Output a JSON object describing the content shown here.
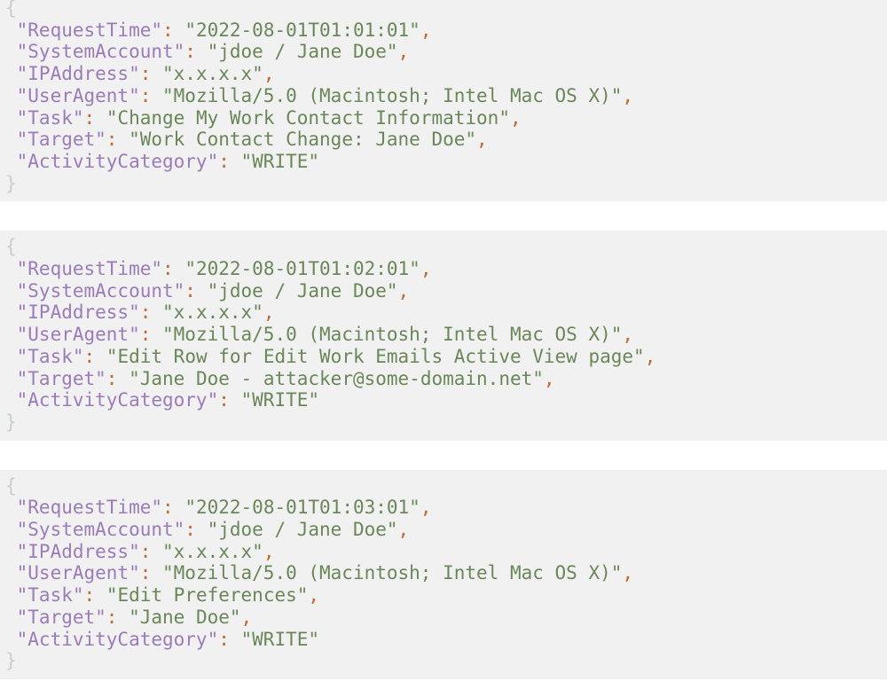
{
  "colors": {
    "block_background": "#f1f1f1",
    "page_background": "#ffffff",
    "key": "#9b7cb8",
    "string": "#6a8759",
    "punctuation": "#c06a33",
    "brace": "#c8ccd4"
  },
  "syntax": {
    "open_brace": "{",
    "close_brace": "}",
    "colon": ":",
    "comma": ",",
    "quote": "\""
  },
  "log_entries": [
    {
      "fields": [
        {
          "key": "RequestTime",
          "value": "2022-08-01T01:01:01",
          "trailing_comma": true
        },
        {
          "key": "SystemAccount",
          "value": "jdoe / Jane Doe",
          "trailing_comma": true
        },
        {
          "key": "IPAddress",
          "value": "x.x.x.x",
          "trailing_comma": true
        },
        {
          "key": "UserAgent",
          "value": "Mozilla/5.0 (Macintosh; Intel Mac OS X)",
          "trailing_comma": true
        },
        {
          "key": "Task",
          "value": "Change My Work Contact Information",
          "trailing_comma": true
        },
        {
          "key": "Target",
          "value": "Work Contact Change: Jane Doe",
          "trailing_comma": true
        },
        {
          "key": "ActivityCategory",
          "value": "WRITE",
          "trailing_comma": false
        }
      ]
    },
    {
      "fields": [
        {
          "key": "RequestTime",
          "value": "2022-08-01T01:02:01",
          "trailing_comma": true
        },
        {
          "key": "SystemAccount",
          "value": "jdoe / Jane Doe",
          "trailing_comma": true
        },
        {
          "key": "IPAddress",
          "value": "x.x.x.x",
          "trailing_comma": true
        },
        {
          "key": "UserAgent",
          "value": "Mozilla/5.0 (Macintosh; Intel Mac OS X)",
          "trailing_comma": true
        },
        {
          "key": "Task",
          "value": "Edit Row for Edit Work Emails Active View page",
          "trailing_comma": true
        },
        {
          "key": "Target",
          "value": "Jane Doe - attacker@some-domain.net",
          "trailing_comma": true
        },
        {
          "key": "ActivityCategory",
          "value": "WRITE",
          "trailing_comma": false
        }
      ]
    },
    {
      "fields": [
        {
          "key": "RequestTime",
          "value": "2022-08-01T01:03:01",
          "trailing_comma": true
        },
        {
          "key": "SystemAccount",
          "value": "jdoe / Jane Doe",
          "trailing_comma": true
        },
        {
          "key": "IPAddress",
          "value": "x.x.x.x",
          "trailing_comma": true
        },
        {
          "key": "UserAgent",
          "value": "Mozilla/5.0 (Macintosh; Intel Mac OS X)",
          "trailing_comma": true
        },
        {
          "key": "Task",
          "value": "Edit Preferences",
          "trailing_comma": true
        },
        {
          "key": "Target",
          "value": "Jane Doe",
          "trailing_comma": true
        },
        {
          "key": "ActivityCategory",
          "value": "WRITE",
          "trailing_comma": false
        }
      ]
    }
  ]
}
